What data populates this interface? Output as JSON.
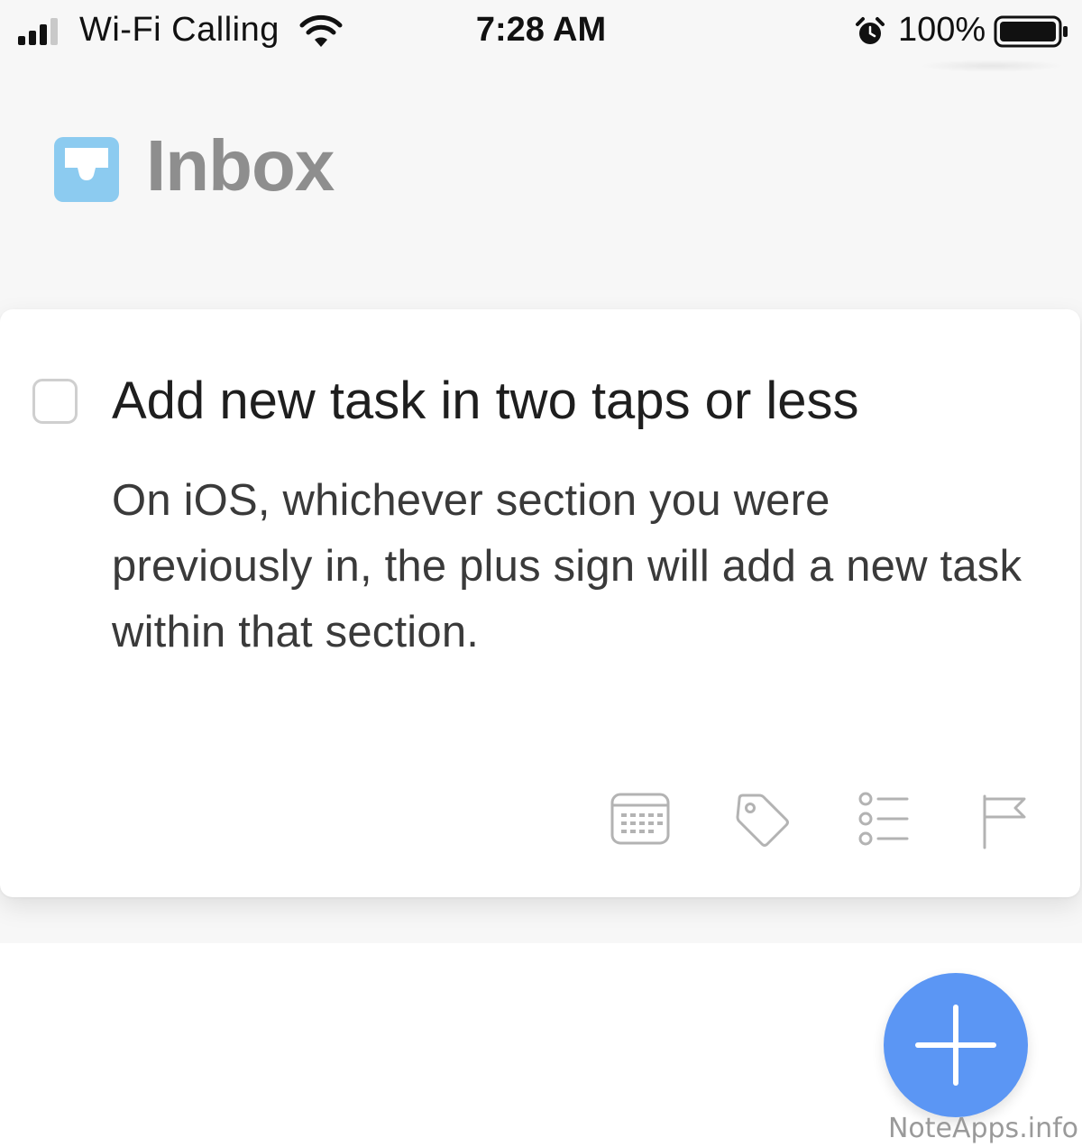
{
  "status_bar": {
    "carrier": "Wi-Fi Calling",
    "time": "7:28 AM",
    "battery": "100%"
  },
  "header": {
    "title": "Inbox",
    "icon": "inbox-tray-icon",
    "icon_color": "#8ccbf0",
    "title_color": "#8e8e8e"
  },
  "task": {
    "title": "Add new task in two taps or less",
    "note": "On iOS, whichever section you were previously in, the plus sign will add a new task within that section.",
    "completed": false,
    "toolbar": [
      {
        "icon": "calendar-icon"
      },
      {
        "icon": "tag-icon"
      },
      {
        "icon": "checklist-icon"
      },
      {
        "icon": "flag-icon"
      }
    ]
  },
  "fab": {
    "icon": "plus-icon",
    "color": "#5b96f4"
  },
  "watermark": "NoteApps.info"
}
